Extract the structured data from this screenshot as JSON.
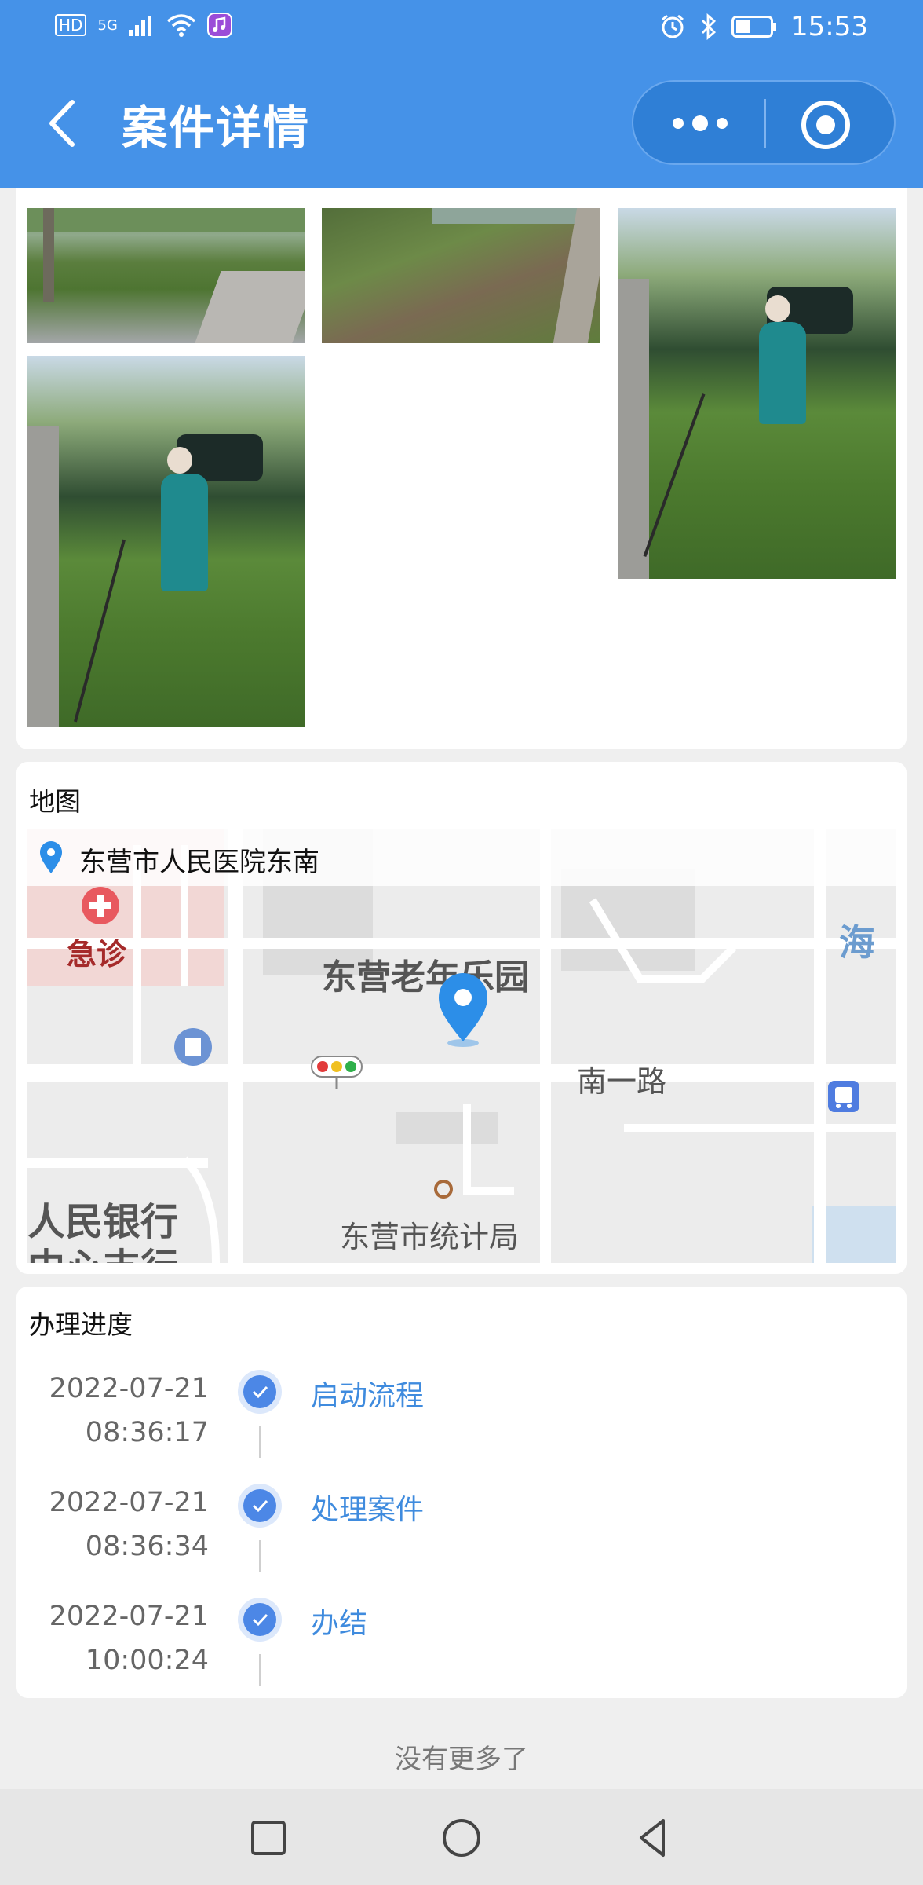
{
  "status_bar": {
    "left_indicators": [
      "HD",
      "5G"
    ],
    "time": "15:53"
  },
  "nav": {
    "title": "案件详情",
    "back_icon": "chevron-left-icon",
    "more_icon": "more-dots-icon",
    "target_icon": "target-icon"
  },
  "photos_section": {
    "photo_count": 4
  },
  "map_section": {
    "title": "地图",
    "location": "东营市人民医院东南",
    "labels": {
      "emergency": "急诊",
      "park": "东营老年乐园",
      "road": "南一路",
      "bureau": "东营市统计局",
      "bank_1": "人民银行",
      "bank_2": "中心支行",
      "hai": "海"
    }
  },
  "progress_section": {
    "title": "办理进度",
    "steps": [
      {
        "date": "2022-07-21",
        "time": "08:36:17",
        "name": "启动流程"
      },
      {
        "date": "2022-07-21",
        "time": "08:36:34",
        "name": "处理案件"
      },
      {
        "date": "2022-07-21",
        "time": "10:00:24",
        "name": "办结"
      }
    ]
  },
  "footer": {
    "no_more": "没有更多了"
  },
  "colors": {
    "primary": "#4592e8",
    "accent_text": "#3f8bde",
    "check": "#4c87e6"
  }
}
